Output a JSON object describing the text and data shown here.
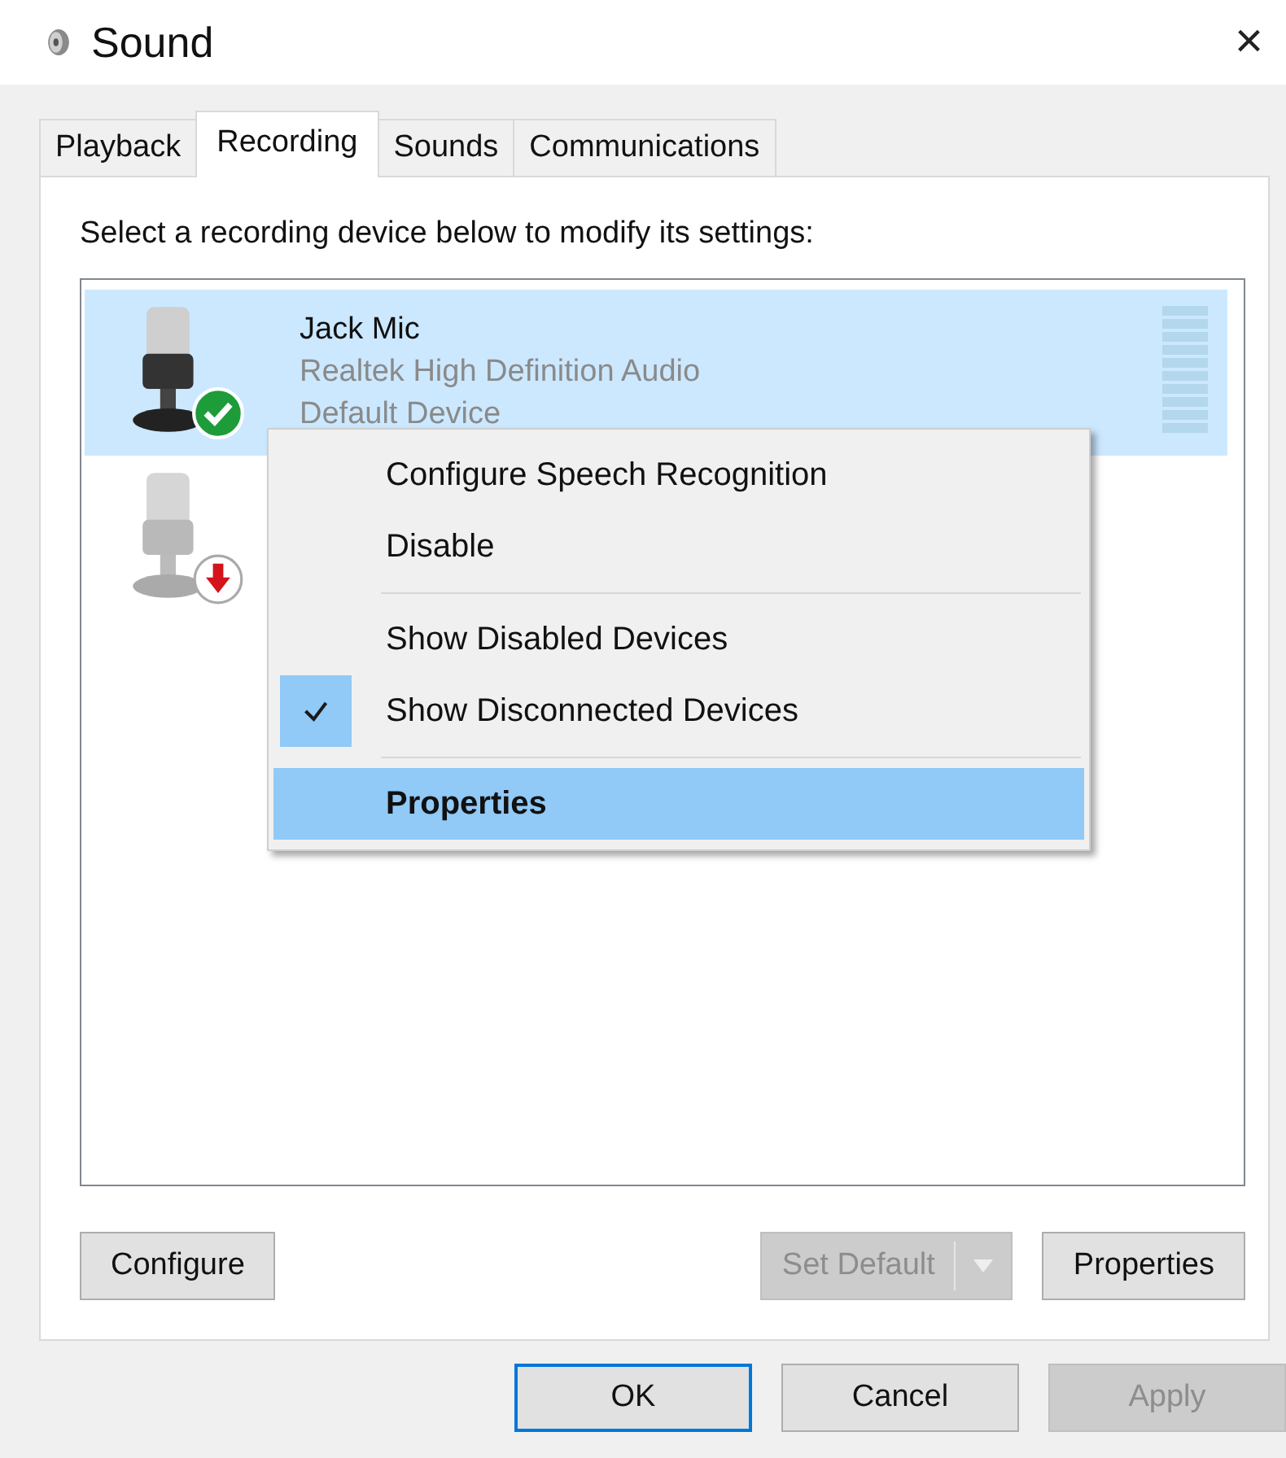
{
  "window": {
    "title": "Sound",
    "close": "×"
  },
  "tabs": [
    {
      "label": "Playback",
      "selected": false
    },
    {
      "label": "Recording",
      "selected": true
    },
    {
      "label": "Sounds",
      "selected": false
    },
    {
      "label": "Communications",
      "selected": false
    }
  ],
  "instruction": "Select a recording device below to modify its settings:",
  "devices": [
    {
      "kind": "default",
      "name": "Jack Mic",
      "driver": "Realtek High Definition Audio",
      "status": "Default Device",
      "selected": true
    },
    {
      "kind": "disconnected",
      "selected": false
    }
  ],
  "context_menu": [
    {
      "kind": "item",
      "label": "Configure Speech Recognition",
      "checked": false,
      "selected": false,
      "default": false
    },
    {
      "kind": "item",
      "label": "Disable",
      "checked": false,
      "selected": false,
      "default": false
    },
    {
      "kind": "separator"
    },
    {
      "kind": "item",
      "label": "Show Disabled Devices",
      "checked": false,
      "selected": false,
      "default": false
    },
    {
      "kind": "item",
      "label": "Show Disconnected Devices",
      "checked": true,
      "selected": false,
      "default": false
    },
    {
      "kind": "separator"
    },
    {
      "kind": "item",
      "label": "Properties",
      "checked": false,
      "selected": true,
      "default": true
    }
  ],
  "panel_buttons": [
    {
      "kind": "button",
      "label": "Configure",
      "disabled": false
    },
    {
      "kind": "split",
      "label": "Set Default",
      "disabled": true
    },
    {
      "kind": "button",
      "label": "Properties",
      "disabled": false
    }
  ],
  "dialog_buttons": [
    {
      "label": "OK",
      "disabled": false,
      "focused": true
    },
    {
      "label": "Cancel",
      "disabled": false,
      "focused": false
    },
    {
      "label": "Apply",
      "disabled": true,
      "focused": false
    }
  ]
}
